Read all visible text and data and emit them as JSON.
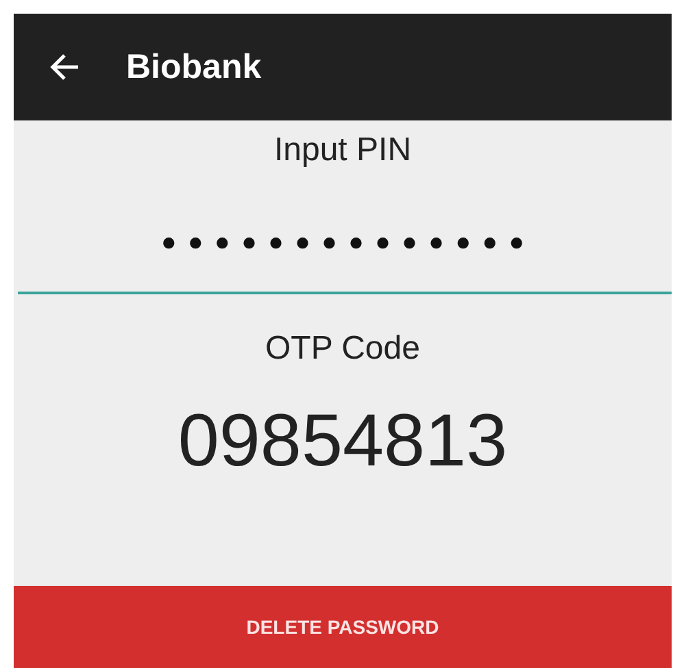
{
  "app_bar": {
    "title": "Biobank"
  },
  "pin": {
    "label": "Input PIN",
    "value": "••••••••••••••"
  },
  "otp": {
    "label": "OTP Code",
    "code": "09854813"
  },
  "buttons": [
    "DELETE PASSWORD"
  ]
}
